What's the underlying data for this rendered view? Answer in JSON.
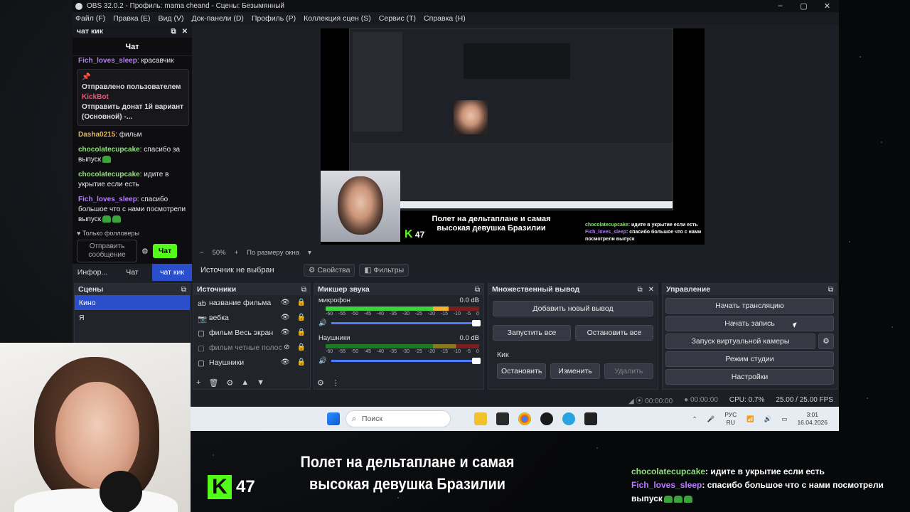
{
  "window": {
    "title": "OBS 32.0.2 - Профиль: mama cheand - Сцены: Безымянный",
    "controls": [
      "‒",
      "▢",
      "✕"
    ]
  },
  "menu": [
    "Файл (F)",
    "Правка (E)",
    "Вид (V)",
    "Док-панели (D)",
    "Профиль (P)",
    "Коллекция сцен (S)",
    "Сервис (T)",
    "Справка (H)"
  ],
  "chat_dock": {
    "title": "чат кик",
    "header": "Чат",
    "top_line": {
      "user": "Fich_loves_sleep",
      "text": ": красавчик"
    },
    "pinned": {
      "label": "Отправлено пользователем",
      "user": "KickBot",
      "text": "Отправить донат 1й вариант (Основной) -..."
    },
    "messages": [
      {
        "user": "Dasha0215",
        "text": ": фильм",
        "color": "#e6b34c"
      },
      {
        "user": "chocolatecupcake",
        "text": ": спасибо за выпуск",
        "color": "#8ee07a"
      },
      {
        "user": "chocolatecupcake",
        "text": ": идите в укрытие если есть",
        "color": "#8ee07a"
      },
      {
        "user": "Fich_loves_sleep",
        "text": ": спасибо большое что с нами посмотрели выпуск",
        "color": "#b77dff"
      }
    ],
    "followers_only": "Только фолловеры",
    "input_placeholder": "Отправить сообщение",
    "send_label": "Чат",
    "tabs": [
      "Инфор...",
      "Чат",
      "чат кик"
    ]
  },
  "preview": {
    "zoom": "50%",
    "fit": "По размеру окна",
    "overlay_title": "Полет на дельтаплане и самая высокая девушка Бразилии",
    "overlay_logo_num": "47",
    "overlay_chat": [
      {
        "user": "chocolatecupcake",
        "text": ": идите в укрытие если есть"
      },
      {
        "user": "Fich_loves_sleep",
        "text": ": спасибо большое что с нами посмотрели выпуск"
      }
    ]
  },
  "source_bar": {
    "no_source": "Источник не выбран",
    "properties": "Свойства",
    "filters": "Фильтры"
  },
  "scenes": {
    "title": "Сцены",
    "items": [
      "Кино",
      "Я"
    ]
  },
  "sources": {
    "title": "Источники",
    "items": [
      "название фильма",
      "вебка",
      "фильм Весь экран",
      "фильм четные полос",
      "Наушники"
    ]
  },
  "mixer": {
    "title": "Микшер звука",
    "channels": [
      {
        "name": "микрофон",
        "level": "0.0 dB"
      },
      {
        "name": "Наушники",
        "level": "0.0 dB"
      }
    ],
    "scale": [
      "-60",
      "-55",
      "-50",
      "-45",
      "-40",
      "-35",
      "-30",
      "-25",
      "-20",
      "-15",
      "-10",
      "-5",
      "0"
    ]
  },
  "multi_output": {
    "title": "Множественный вывод",
    "add": "Добавить новый вывод",
    "start_all": "Запустить все",
    "stop_all": "Остановить все",
    "target": "Кик",
    "stop": "Остановить",
    "edit": "Изменить",
    "delete": "Удалить"
  },
  "controls": {
    "title": "Управление",
    "buttons": [
      "Начать трансляцию",
      "Начать запись",
      "Запуск виртуальной камеры",
      "Режим студии",
      "Настройки"
    ]
  },
  "status": {
    "time1": "00:00:00",
    "time2": "00:00:00",
    "cpu": "CPU: 0.7%",
    "fps": "25.00 / 25.00 FPS"
  },
  "taskbar": {
    "search": "Поиск",
    "lang1": "РУС",
    "lang2": "RU",
    "time": "3:01",
    "date": "16.04.2026"
  },
  "stream_overlay": {
    "logo_letter": "K",
    "logo_num": "47",
    "title": "Полет на дельтаплане и самая высокая девушка Бразилии",
    "chat": [
      {
        "user": "chocolatecupcake",
        "text": ": идите в укрытие если есть"
      },
      {
        "user": "Fich_loves_sleep",
        "text": ": спасибо большое что с нами посмотрели выпуск"
      }
    ]
  },
  "colors": {
    "kick_green": "#53fc18",
    "obs_bg": "#1d1f26",
    "selected": "#2b4fcc"
  }
}
